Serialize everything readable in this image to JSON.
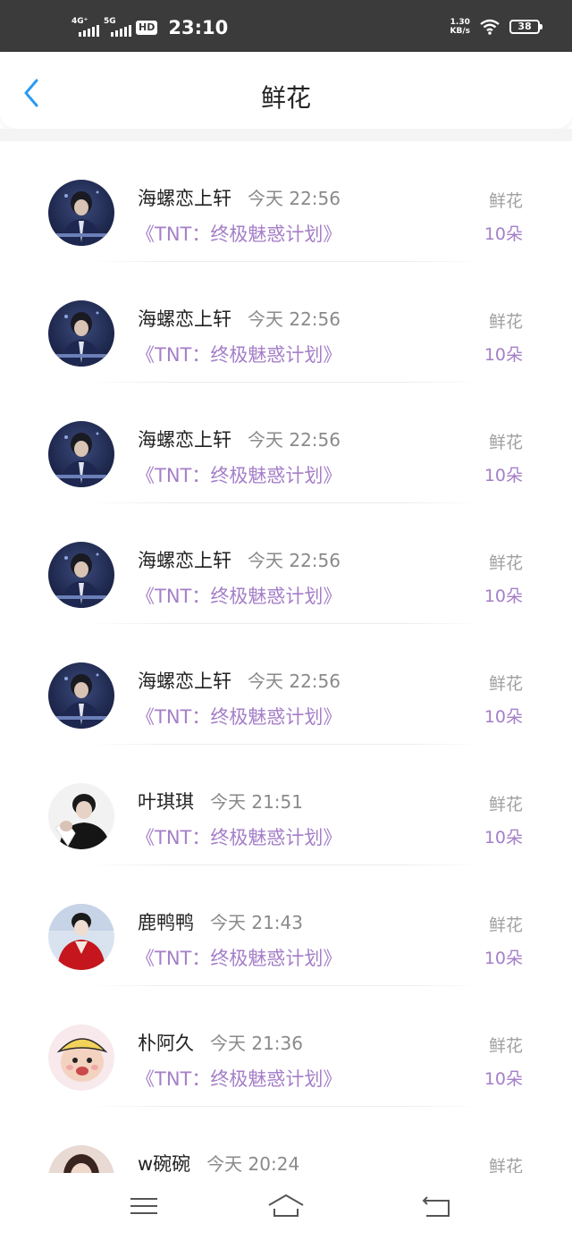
{
  "status_bar": {
    "net1": "4G⁺",
    "net2": "5G",
    "hd": "HD",
    "time": "23:10",
    "speed_value": "1.30",
    "speed_unit": "KB/s",
    "battery": "38"
  },
  "header": {
    "title": "鲜花",
    "back_icon": "chevron-left-icon"
  },
  "list": [
    {
      "name": "海螺恋上轩",
      "time": "今天 22:56",
      "book": "《TNT：终极魅惑计划》",
      "tag": "鲜花",
      "count": "10朵",
      "avatar": "dark-suit"
    },
    {
      "name": "海螺恋上轩",
      "time": "今天 22:56",
      "book": "《TNT：终极魅惑计划》",
      "tag": "鲜花",
      "count": "10朵",
      "avatar": "dark-suit"
    },
    {
      "name": "海螺恋上轩",
      "time": "今天 22:56",
      "book": "《TNT：终极魅惑计划》",
      "tag": "鲜花",
      "count": "10朵",
      "avatar": "dark-suit"
    },
    {
      "name": "海螺恋上轩",
      "time": "今天 22:56",
      "book": "《TNT：终极魅惑计划》",
      "tag": "鲜花",
      "count": "10朵",
      "avatar": "dark-suit"
    },
    {
      "name": "海螺恋上轩",
      "time": "今天 22:56",
      "book": "《TNT：终极魅惑计划》",
      "tag": "鲜花",
      "count": "10朵",
      "avatar": "dark-suit"
    },
    {
      "name": "叶琪琪",
      "time": "今天 21:51",
      "book": "《TNT：终极魅惑计划》",
      "tag": "鲜花",
      "count": "10朵",
      "avatar": "black-white"
    },
    {
      "name": "鹿鸭鸭",
      "time": "今天 21:43",
      "book": "《TNT：终极魅惑计划》",
      "tag": "鲜花",
      "count": "10朵",
      "avatar": "red-costume"
    },
    {
      "name": "朴阿久",
      "time": "今天 21:36",
      "book": "《TNT：终极魅惑计划》",
      "tag": "鲜花",
      "count": "10朵",
      "avatar": "child-hat"
    },
    {
      "name": "w碗碗",
      "time": "今天 20:24",
      "book": "",
      "tag": "鲜花",
      "count": "",
      "avatar": "woman"
    }
  ],
  "nav": {
    "menu": "menu-icon",
    "home": "home-icon",
    "back": "back-icon"
  }
}
